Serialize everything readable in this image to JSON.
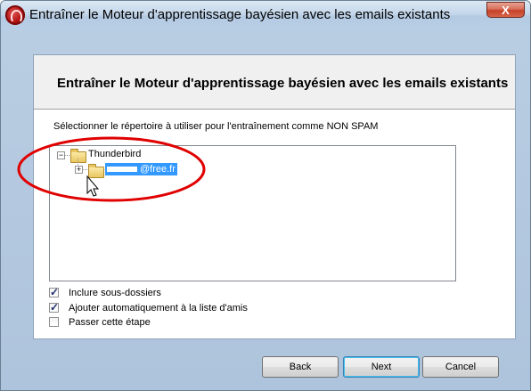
{
  "window": {
    "title": "Entraîner le Moteur d'apprentissage bayésien avec les emails existants",
    "close_label": "X"
  },
  "dialog": {
    "title": "Entraîner le Moteur d'apprentissage bayésien avec les emails existants",
    "instruction": "Sélectionner le répertoire à utiliser pour l'entraînement comme NON SPAM"
  },
  "tree": {
    "root_expander": "−",
    "root_label": "Thunderbird",
    "child_expander": "+",
    "child_label": "@free.fr"
  },
  "options": [
    {
      "label": "Inclure sous-dossiers",
      "checked": true
    },
    {
      "label": "Ajouter automatiquement à la liste d'amis",
      "checked": true
    },
    {
      "label": "Passer cette étape",
      "checked": false
    }
  ],
  "buttons": {
    "back": "Back",
    "next": "Next",
    "cancel": "Cancel"
  },
  "colors": {
    "selection": "#3399ff",
    "annotation": "#e00000",
    "close": "#c64128"
  },
  "icons": {
    "app": "app-logo-icon",
    "folder": "folder-icon",
    "cursor": "mouse-pointer-icon"
  }
}
